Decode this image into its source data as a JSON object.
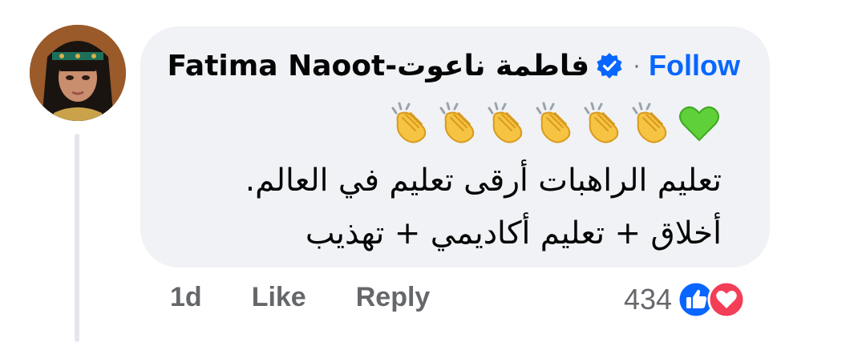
{
  "comment": {
    "author": "Fatima Naoot-فاطمة ناعوت",
    "separator": "·",
    "follow_label": "Follow",
    "emojis": [
      "clapping-hands",
      "clapping-hands",
      "clapping-hands",
      "clapping-hands",
      "clapping-hands",
      "clapping-hands",
      "green-heart"
    ],
    "text_lines": [
      "تعليم الراهبات أرقى تعليم في العالم.",
      "أخلاق + تعليم أكاديمي + تهذيب"
    ],
    "time": "1d",
    "like_label": "Like",
    "reply_label": "Reply",
    "reaction_count": "434",
    "reaction_icons": [
      "like-icon",
      "love-icon"
    ]
  },
  "colors": {
    "bubble": "#f0f2f5",
    "link": "#0866ff",
    "meta": "#65676b",
    "like": "#0866ff",
    "love": "#f33e58"
  }
}
